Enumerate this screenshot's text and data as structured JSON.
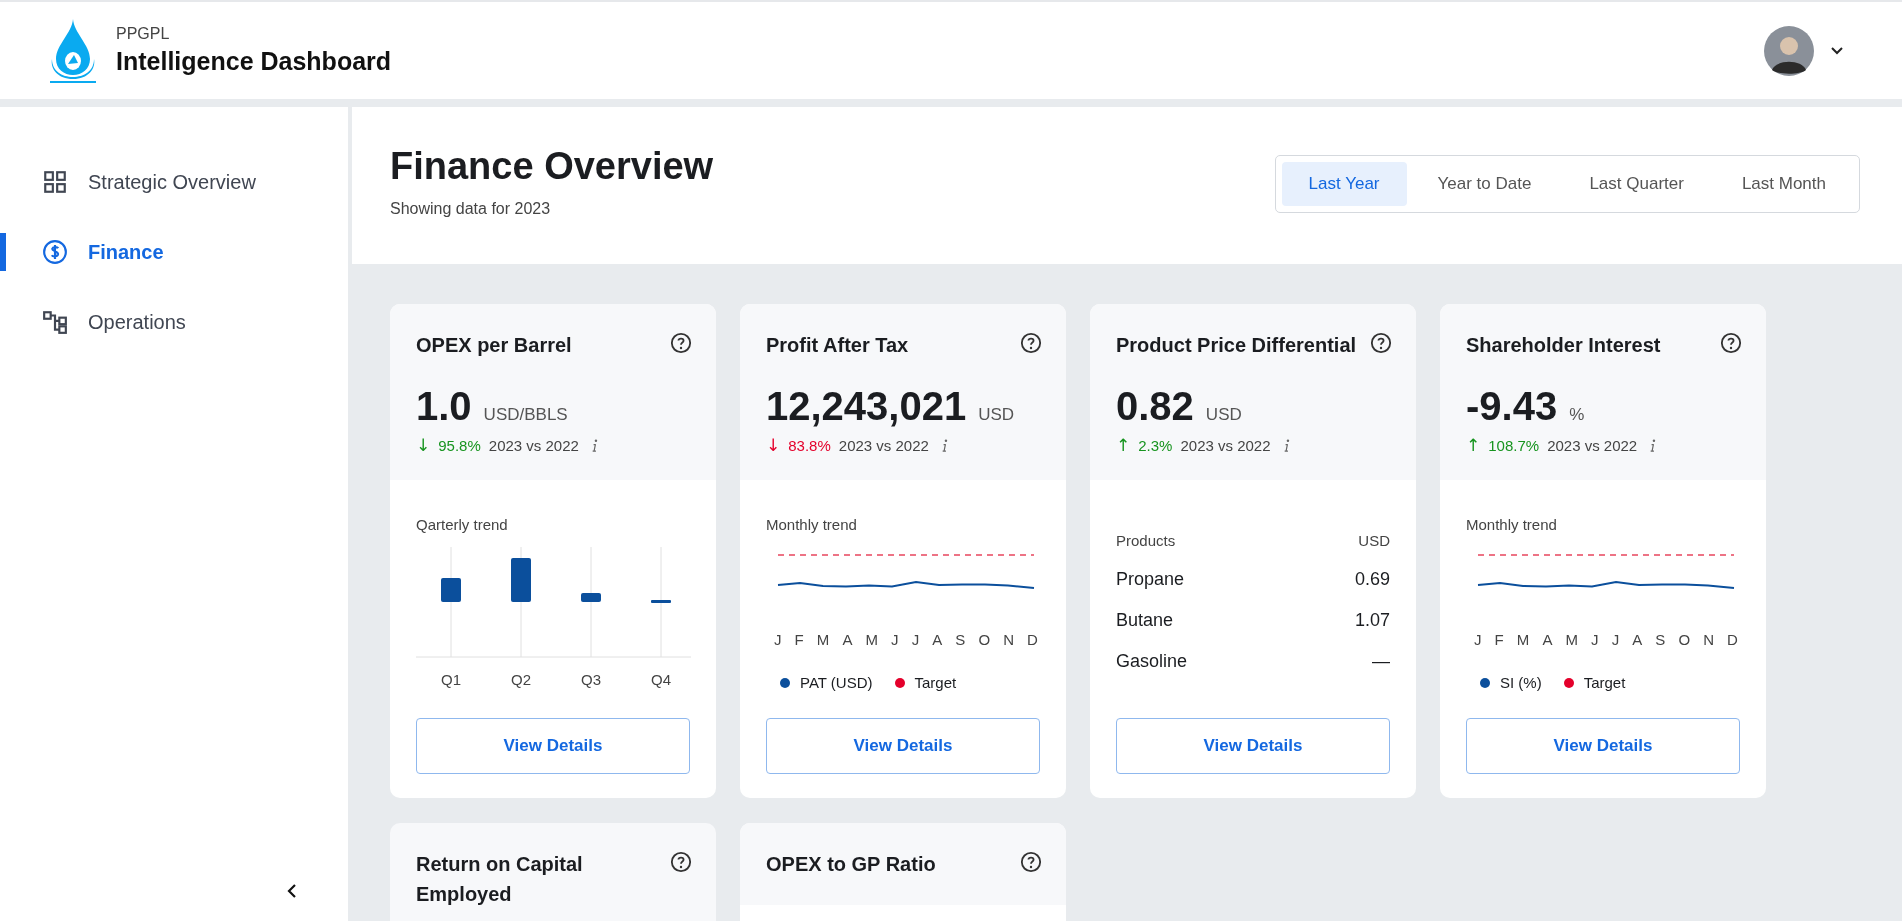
{
  "header": {
    "org": "PPGPL",
    "title": "Intelligence Dashboard"
  },
  "sidebar": {
    "items": [
      {
        "label": "Strategic Overview",
        "selected": false
      },
      {
        "label": "Finance",
        "selected": true
      },
      {
        "label": "Operations",
        "selected": false
      }
    ]
  },
  "page": {
    "title": "Finance Overview",
    "subtitle": "Showing data for 2023"
  },
  "period_tabs": [
    {
      "label": "Last Year",
      "selected": true
    },
    {
      "label": "Year to Date",
      "selected": false
    },
    {
      "label": "Last Quarter",
      "selected": false
    },
    {
      "label": "Last Month",
      "selected": false
    }
  ],
  "cards": [
    {
      "kind": "bars",
      "title": "OPEX per Barrel",
      "value": "1.0",
      "unit": "USD/BBLS",
      "delta": {
        "arrow": "↓",
        "good": true,
        "percent": "95.8%",
        "label": "2023 vs 2022"
      },
      "chart_title": "Qarterly trend",
      "x_labels": [
        "Q1",
        "Q2",
        "Q3",
        "Q4"
      ],
      "button": "View Details"
    },
    {
      "kind": "line",
      "title": "Profit After Tax",
      "value": "12,243,021",
      "unit": "USD",
      "delta": {
        "arrow": "↓",
        "good": false,
        "percent": "83.8%",
        "label": "2023 vs 2022"
      },
      "chart_title": "Monthly trend",
      "x_labels": [
        "J",
        "F",
        "M",
        "A",
        "M",
        "J",
        "J",
        "A",
        "S",
        "O",
        "N",
        "D"
      ],
      "legend": [
        {
          "label": "PAT (USD)",
          "color": "#0b4f9c"
        },
        {
          "label": "Target",
          "color": "#e4002b"
        }
      ],
      "button": "View Details"
    },
    {
      "kind": "table",
      "title": "Product Price Differential",
      "value": "0.82",
      "unit": "USD",
      "delta": {
        "arrow": "↑",
        "good": true,
        "percent": "2.3%",
        "label": "2023 vs 2022"
      },
      "columns": [
        "Products",
        "USD"
      ],
      "rows": [
        {
          "name": "Propane",
          "value": "0.69"
        },
        {
          "name": "Butane",
          "value": "1.07"
        },
        {
          "name": "Gasoline",
          "value": "—"
        }
      ],
      "button": "View Details"
    },
    {
      "kind": "line",
      "title": "Shareholder Interest",
      "value": "-9.43",
      "unit": "%",
      "delta": {
        "arrow": "↑",
        "good": true,
        "percent": "108.7%",
        "label": "2023 vs 2022"
      },
      "chart_title": "Monthly trend",
      "x_labels": [
        "J",
        "F",
        "M",
        "A",
        "M",
        "J",
        "J",
        "A",
        "S",
        "O",
        "N",
        "D"
      ],
      "legend": [
        {
          "label": "SI (%)",
          "color": "#0b4f9c"
        },
        {
          "label": "Target",
          "color": "#e4002b"
        }
      ],
      "button": "View Details"
    },
    {
      "kind": "partial",
      "title": "Return on Capital Employed"
    },
    {
      "kind": "partial",
      "title": "OPEX to GP Ratio"
    }
  ]
}
